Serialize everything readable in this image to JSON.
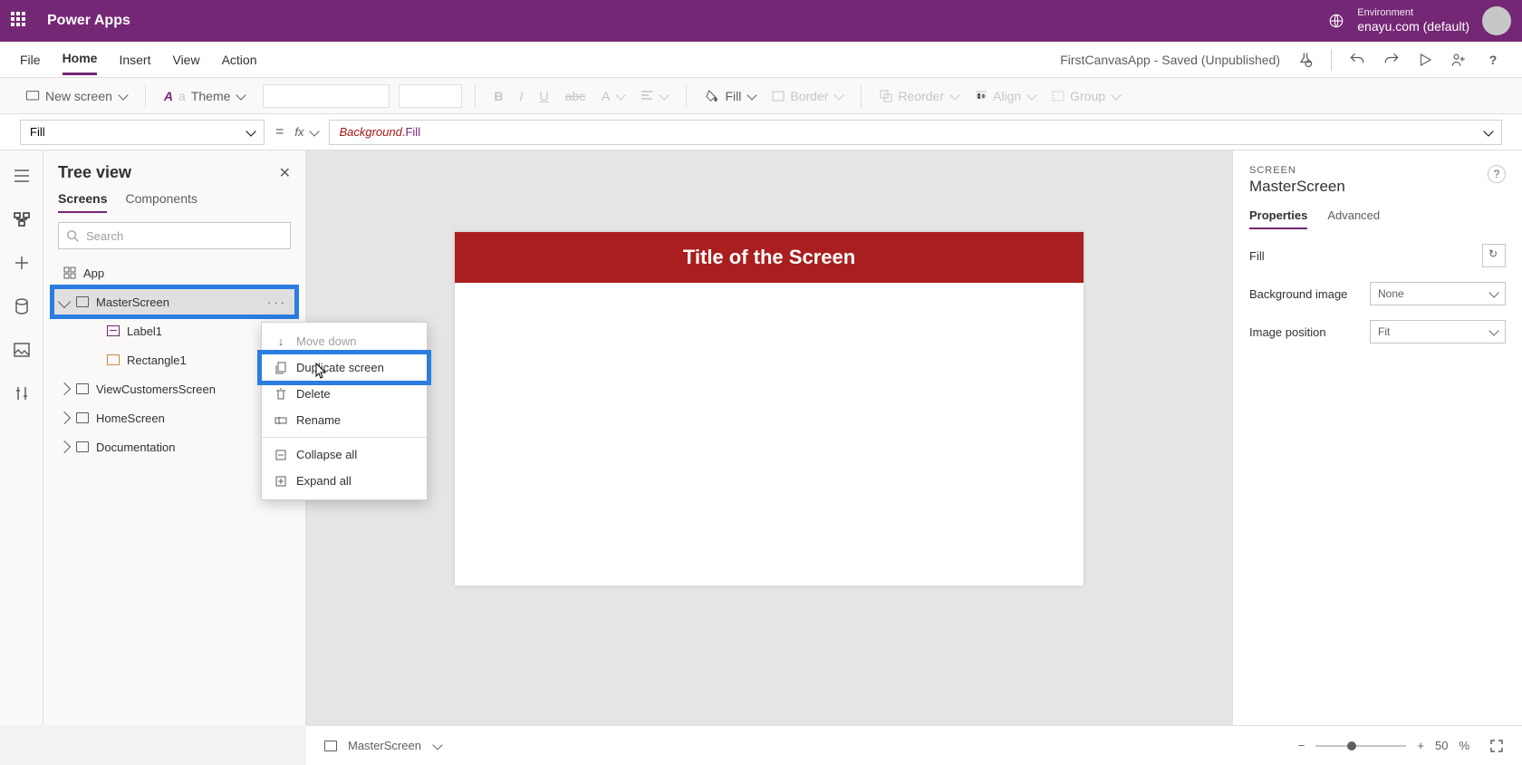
{
  "header": {
    "appName": "Power Apps",
    "envLabel": "Environment",
    "envValue": "enayu.com (default)"
  },
  "menubar": {
    "items": [
      "File",
      "Home",
      "Insert",
      "View",
      "Action"
    ],
    "activeIndex": 1,
    "status": "FirstCanvasApp - Saved (Unpublished)"
  },
  "ribbon": {
    "newScreen": "New screen",
    "theme": "Theme",
    "fill": "Fill",
    "border": "Border",
    "reorder": "Reorder",
    "align": "Align",
    "group": "Group"
  },
  "formulaBar": {
    "property": "Fill",
    "formulaObject": "Background",
    "formulaProp": ".Fill"
  },
  "treeView": {
    "title": "Tree view",
    "tabs": [
      "Screens",
      "Components"
    ],
    "activeTab": 0,
    "searchPlaceholder": "Search",
    "items": {
      "app": "App",
      "master": "MasterScreen",
      "label1": "Label1",
      "rect1": "Rectangle1",
      "viewCustomers": "ViewCustomersScreen",
      "home": "HomeScreen",
      "documentation": "Documentation"
    }
  },
  "contextMenu": {
    "moveDown": "Move down",
    "duplicate": "Duplicate screen",
    "delete": "Delete",
    "rename": "Rename",
    "collapseAll": "Collapse all",
    "expandAll": "Expand all"
  },
  "canvas": {
    "titleText": "Title of the Screen"
  },
  "canvasFooter": {
    "screenName": "MasterScreen",
    "zoomValue": "50",
    "zoomUnit": "%"
  },
  "propsPanel": {
    "kicker": "SCREEN",
    "title": "MasterScreen",
    "tabs": [
      "Properties",
      "Advanced"
    ],
    "activeTab": 0,
    "rows": {
      "fill": "Fill",
      "bgImage": "Background image",
      "bgImageVal": "None",
      "imgPos": "Image position",
      "imgPosVal": "Fit"
    }
  }
}
